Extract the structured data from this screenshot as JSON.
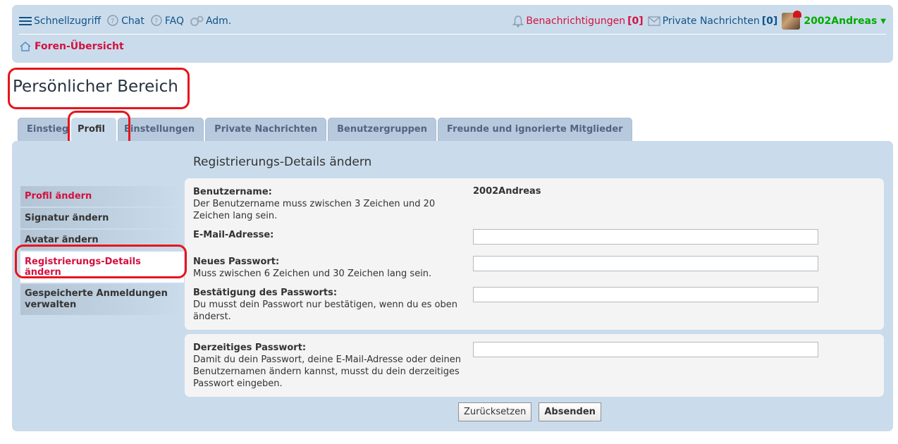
{
  "nav": {
    "quicklinks": "Schnellzugriff",
    "chat": "Chat",
    "faq": "FAQ",
    "admin": "Adm.",
    "notifications_label": "Benachrichtigungen",
    "notifications_count": "[0]",
    "pm_label": "Private Nachrichten",
    "pm_count": "[0]",
    "username": "2002Andreas",
    "breadcrumb": "Foren-Übersicht"
  },
  "page": {
    "title": "Persönlicher Bereich"
  },
  "tabs": [
    {
      "label": "Einstieg"
    },
    {
      "label": "Profil"
    },
    {
      "label": "Einstellungen"
    },
    {
      "label": "Private Nachrichten"
    },
    {
      "label": "Benutzergruppen"
    },
    {
      "label": "Freunde und ignorierte Mitglieder"
    }
  ],
  "panel": {
    "heading": "Registrierungs-Details ändern"
  },
  "sidebar": [
    {
      "label": "Profil ändern"
    },
    {
      "label": "Signatur ändern"
    },
    {
      "label": "Avatar ändern"
    },
    {
      "label": "Registrierungs-Details ändern"
    },
    {
      "label": "Gespeicherte Anmeldungen verwalten"
    }
  ],
  "form": {
    "username_label": "Benutzername:",
    "username_desc": "Der Benutzername muss zwischen 3 Zeichen und 20 Zeichen lang sein.",
    "username_value": "2002Andreas",
    "email_label": "E-Mail-Adresse:",
    "email_value": "",
    "new_pw_label": "Neues Passwort:",
    "new_pw_desc": "Muss zwischen 6 Zeichen und 30 Zeichen lang sein.",
    "confirm_pw_label": "Bestätigung des Passworts:",
    "confirm_pw_desc": "Du musst dein Passwort nur bestätigen, wenn du es oben änderst.",
    "current_pw_label": "Derzeitiges Passwort:",
    "current_pw_desc": "Damit du dein Passwort, deine E-Mail-Adresse oder deinen Benutzernamen ändern kannst, musst du dein derzeitiges Passwort eingeben."
  },
  "buttons": {
    "reset": "Zurücksetzen",
    "submit": "Absenden"
  },
  "colors": {
    "panel_bg": "#cadceb",
    "link_red": "#d31141",
    "link_blue": "#105289",
    "user_green": "#00aa00",
    "highlight": "#e8141b"
  }
}
